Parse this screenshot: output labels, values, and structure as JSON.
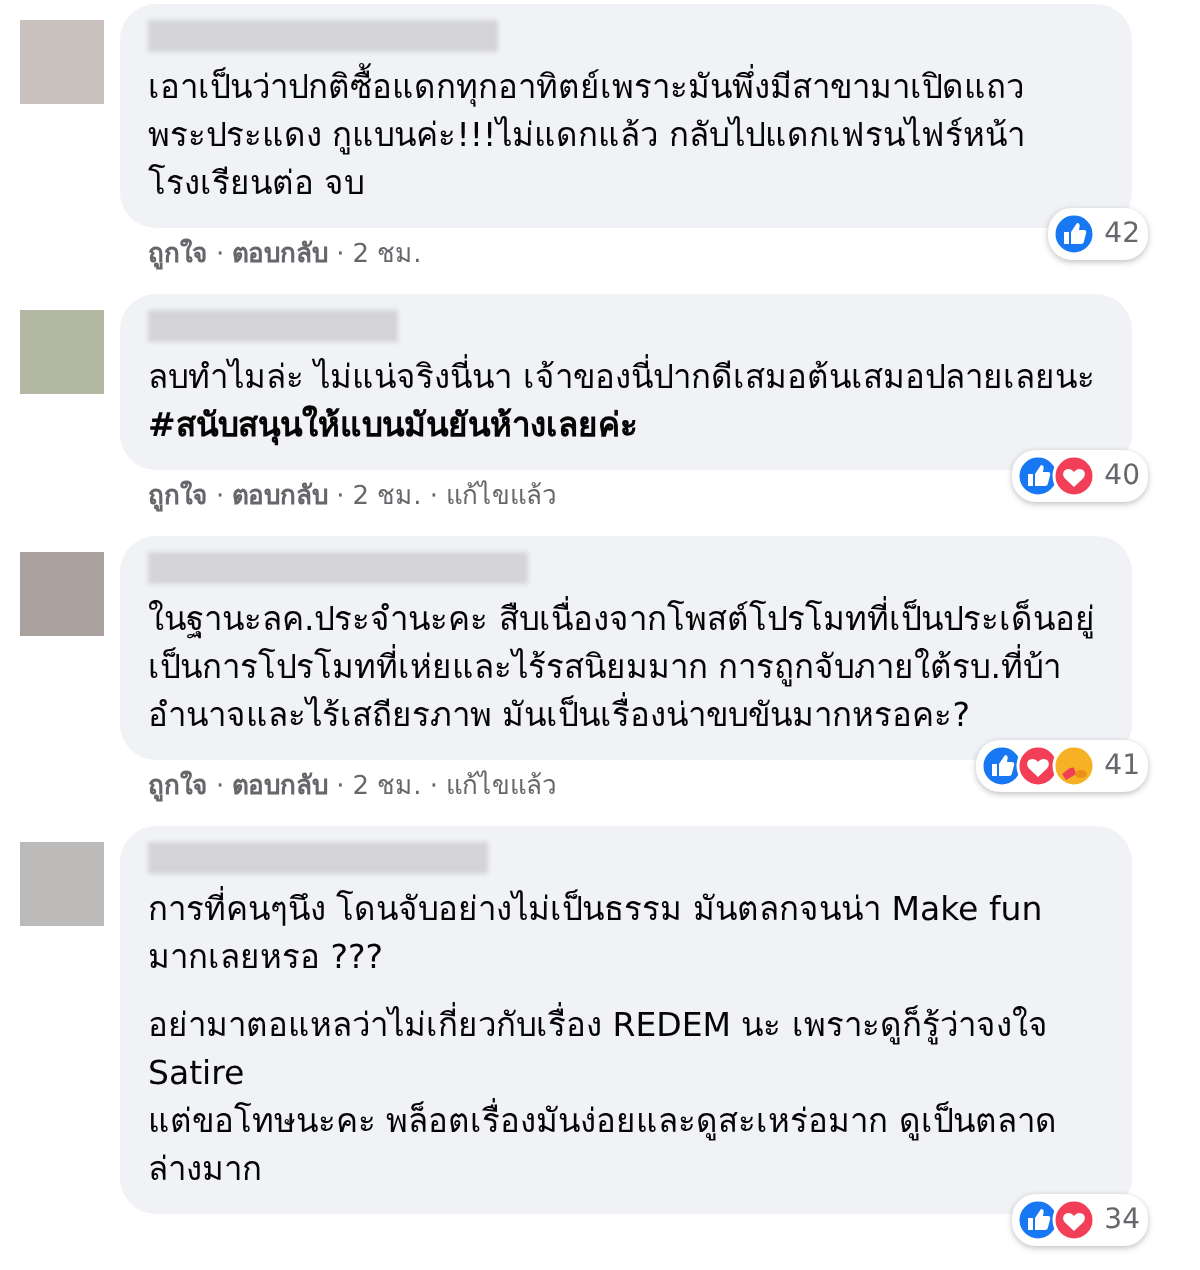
{
  "separator": "·",
  "comments": [
    {
      "color": "#c9c1be",
      "paragraphs": [
        "เอาเป็นว่าปกติซื้อแดกทุกอาทิตย์เพราะมันพึ่งมีสาขามาเปิดแถวพระประแดง กูแบนค่ะ!!!ไม่แดกแล้ว กลับไปแดกเฟรนไฟร์หน้าโรงเรียนต่อ จบ"
      ],
      "reactions": [
        {
          "kind": "like"
        }
      ],
      "reaction_count": "42",
      "actions": {
        "like": "ถูกใจ",
        "reply": "ตอบกลับ",
        "time": "2 ชม."
      }
    },
    {
      "color": "#b3b8a2",
      "paragraphs": [
        "ลบทำไมล่ะ ไม่แน่จริงนี่นา เจ้าของนี่ปากดีเสมอต้นเสมอปลายเลยนะ **#สนับสนุนให้แบนมันยันห้างเลยค่ะ**"
      ],
      "reactions": [
        {
          "kind": "like"
        },
        {
          "kind": "love"
        }
      ],
      "reaction_count": "40",
      "actions": {
        "like": "ถูกใจ",
        "reply": "ตอบกลับ",
        "time": "2 ชม.",
        "edited": "แก้ไขแล้ว"
      }
    },
    {
      "color": "#aaa19f",
      "paragraphs": [
        "ในฐานะลค.ประจำนะคะ สืบเนื่องจากโพสต์โปรโมทที่เป็นประเด็นอยู่ เป็นการโปรโมทที่เห่ยและไร้รสนิยมมาก การถูกจับภายใต้รบ.ที่บ้าอำนาจและไร้เสถียรภาพ มันเป็นเรื่องน่าขบขันมากหรอคะ?"
      ],
      "reactions": [
        {
          "kind": "like"
        },
        {
          "kind": "love"
        },
        {
          "kind": "care"
        }
      ],
      "reaction_count": "41",
      "actions": {
        "like": "ถูกใจ",
        "reply": "ตอบกลับ",
        "time": "2 ชม.",
        "edited": "แก้ไขแล้ว"
      }
    },
    {
      "color": "#bdbbb9",
      "paragraphs": [
        "การที่คนๆนึง โดนจับอย่างไม่เป็นธรรม มันตลกจนน่า Make fun มากเลยหรอ ???",
        "อย่ามาตอแหลว่าไม่เกี่ยวกับเรื่อง REDEM นะ เพราะดูก็รู้ว่าจงใจ Satire\nแต่ขอโทษนะคะ พล็อตเรื่องมันง่อยและดูสะเหร่อมาก ดูเป็นตลาดล่างมาก"
      ],
      "reactions": [
        {
          "kind": "like"
        },
        {
          "kind": "love"
        }
      ],
      "reaction_count": "34"
    }
  ]
}
